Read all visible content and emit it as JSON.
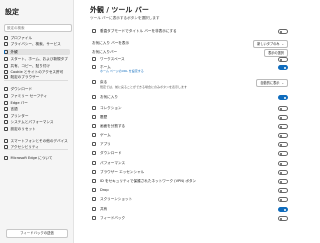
{
  "sidebar": {
    "title": "設定",
    "search_placeholder": "設定の検索",
    "items": [
      {
        "label": "プロファイル",
        "icon": "profile-icon"
      },
      {
        "label": "プライバシー、検索、サービス",
        "icon": "lock-icon"
      },
      {
        "label": "外観",
        "icon": "appearance-icon",
        "active": true
      },
      {
        "label": "スタート、ホーム、および新規タブ",
        "icon": "home-icon"
      },
      {
        "label": "共有、コピー、貼り付け",
        "icon": "share-icon"
      },
      {
        "label": "Cookie とサイトのアクセス許可",
        "icon": "cookie-icon"
      },
      {
        "label": "既定のブラウザー",
        "icon": "browser-icon"
      },
      {
        "label": "ダウンロード",
        "icon": "download-icon"
      },
      {
        "label": "ファミリー セーフティ",
        "icon": "family-icon"
      },
      {
        "label": "Edge バー",
        "icon": "edgebar-icon"
      },
      {
        "label": "言語",
        "icon": "language-icon"
      },
      {
        "label": "プリンター",
        "icon": "printer-icon"
      },
      {
        "label": "システムとパフォーマンス",
        "icon": "system-icon"
      },
      {
        "label": "設定のリセット",
        "icon": "reset-icon"
      },
      {
        "label": "スマートフォンとその他のデバイス",
        "icon": "phone-icon"
      },
      {
        "label": "アクセシビリティ",
        "icon": "accessibility-icon"
      },
      {
        "label": "Microsoft Edge について",
        "icon": "edge-icon"
      }
    ],
    "feedback_label": "フィードバックの送信"
  },
  "main": {
    "title": "外観 / ツール バー",
    "subtitle": "ツール バーに表示するボタンを選択します",
    "rows": [
      {
        "label": "垂直タブモードでタイトル バーを非表示にする",
        "control": "toggle",
        "on": false,
        "icon": "tabs-icon"
      },
      {
        "label": "お気に入り バーを表示",
        "control": "select",
        "value": "新しいタブのみ"
      },
      {
        "label": "お気に入りバー",
        "control": "button",
        "value": "表示の選択"
      },
      {
        "label": "ワークスペース",
        "control": "toggle",
        "on": false,
        "icon": "workspace-icon"
      },
      {
        "label": "ホーム",
        "control": "toggle",
        "on": true,
        "icon": "home-icon",
        "link": "ホーム ページのURL を設定する"
      },
      {
        "label": "戻る",
        "control": "select",
        "value": "自動的に表示",
        "icon": "back-icon",
        "desc": "既定では、前に戻ることができる場合にのみボタンを表示します"
      },
      {
        "label": "お気に入り",
        "control": "toggle",
        "on": true,
        "icon": "star-icon"
      },
      {
        "label": "コレクション",
        "control": "toggle",
        "on": false,
        "icon": "collections-icon"
      },
      {
        "label": "履歴",
        "control": "toggle",
        "on": false,
        "icon": "history-icon"
      },
      {
        "label": "画面を分割する",
        "control": "toggle",
        "on": false,
        "icon": "split-icon"
      },
      {
        "label": "ゲーム",
        "control": "toggle",
        "on": false,
        "icon": "games-icon"
      },
      {
        "label": "アプリ",
        "control": "toggle",
        "on": false,
        "icon": "apps-icon"
      },
      {
        "label": "ダウンロード",
        "control": "toggle",
        "on": false,
        "icon": "download-icon"
      },
      {
        "label": "パフォーマンス",
        "control": "toggle",
        "on": false,
        "icon": "performance-icon"
      },
      {
        "label": "ブラウザー エッセンシャル",
        "control": "toggle",
        "on": false,
        "icon": "essentials-icon"
      },
      {
        "label": "ID をセキュリティで保護されたネットワーク (VPN) ボタン",
        "control": "toggle",
        "on": false,
        "icon": "vpn-icon"
      },
      {
        "label": "Drop",
        "control": "toggle",
        "on": false,
        "icon": "drop-icon"
      },
      {
        "label": "スクリーンショット",
        "control": "toggle",
        "on": false,
        "icon": "screenshot-icon"
      },
      {
        "label": "共有",
        "control": "toggle",
        "on": true,
        "icon": "share-icon"
      },
      {
        "label": "フィードバック",
        "control": "toggle",
        "on": false,
        "icon": "feedback-icon"
      }
    ]
  },
  "colors": {
    "accent": "#0f6cbd",
    "sidebar_bg": "#f5f5f5"
  }
}
